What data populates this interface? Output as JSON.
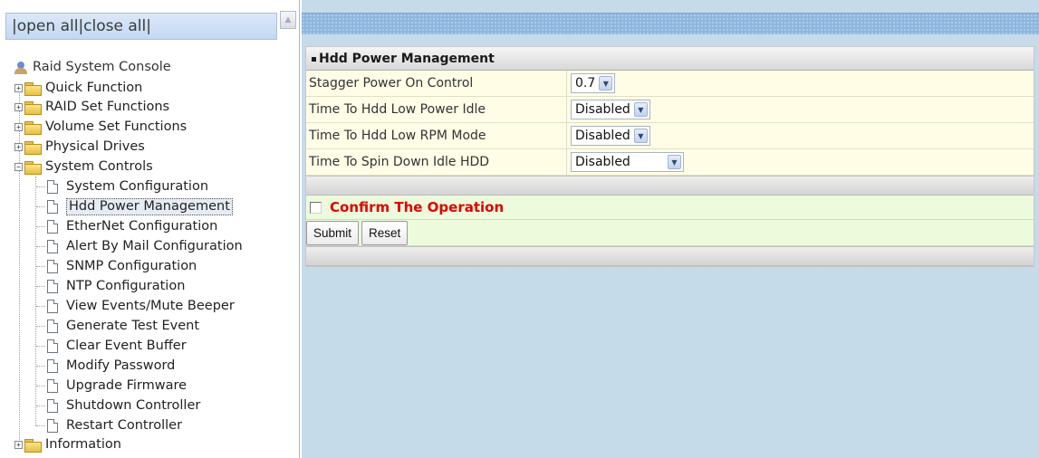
{
  "left_frame": {
    "top_links": {
      "prefix": "|",
      "open_all": "open all",
      "separator": "|",
      "close_all": "close all",
      "suffix": "|"
    },
    "tree": {
      "root": "Raid System Console",
      "quick_function": "Quick Function",
      "raid_set_functions": "RAID Set Functions",
      "volume_set_functions": "Volume Set Functions",
      "physical_drives": "Physical Drives",
      "system_controls": "System Controls",
      "system_controls_items": [
        "System Configuration",
        "Hdd Power Management",
        "EtherNet Configuration",
        "Alert By Mail Configuration",
        "SNMP Configuration",
        "NTP Configuration",
        "View Events/Mute Beeper",
        "Generate Test Event",
        "Clear Event Buffer",
        "Modify Password",
        "Upgrade Firmware",
        "Shutdown Controller",
        "Restart Controller"
      ],
      "information": "Information",
      "selected_item": "Hdd Power Management"
    },
    "expander_collapsed": "+",
    "expander_expanded": "−"
  },
  "main": {
    "panel_title": "Hdd Power Management",
    "settings": [
      {
        "label": "Stagger Power On Control",
        "value": "0.7"
      },
      {
        "label": "Time To Hdd Low Power Idle",
        "value": "Disabled"
      },
      {
        "label": "Time To Hdd Low RPM Mode",
        "value": "Disabled"
      },
      {
        "label": "Time To Spin Down Idle HDD",
        "value": "Disabled"
      }
    ],
    "confirm_label": "Confirm The Operation",
    "confirm_checked": false,
    "submit_label": "Submit",
    "reset_label": "Reset"
  },
  "colors": {
    "confirm_text": "#e00000",
    "panel_bg": "#fffde6",
    "confirm_bg": "#edfbdc",
    "right_frame_bg": "#c6dbea"
  },
  "icons": {
    "root": "console-user-icon",
    "folder": "folder-icon",
    "page": "page-icon",
    "dropdown": "chevron-down-icon"
  }
}
